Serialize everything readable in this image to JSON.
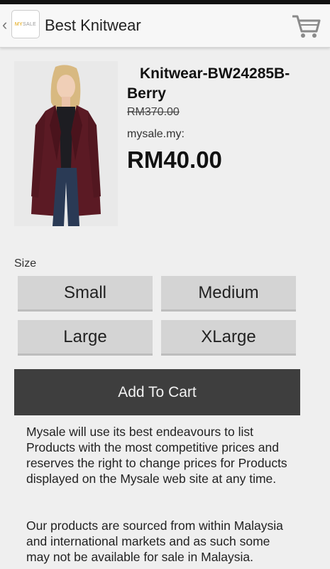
{
  "header": {
    "back_glyph": "‹",
    "logo_text": "MYSALE",
    "title": "Best Knitwear",
    "cart_icon": "cart-icon"
  },
  "product": {
    "name": "Knitwear-BW24285B-Berry",
    "original_price": "RM370.00",
    "source": "mysale.my:",
    "price": "RM40.00"
  },
  "size": {
    "label": "Size",
    "options": [
      "Small",
      "Medium",
      "Large",
      "XLarge"
    ]
  },
  "actions": {
    "add_to_cart": "Add To Cart"
  },
  "disclaimer": {
    "p1": "Mysale will use its best endeavours to list Products with the most competitive prices and reserves the right to change prices for Products displayed on the Mysale web site at any time.",
    "p2": "Our products are sourced from within Malaysia and international markets and as such some may not be available for sale in Malaysia."
  },
  "colors": {
    "accent_dark": "#3e3e3e",
    "garment": "#5b1a24",
    "logo_accent": "#e0a000"
  }
}
